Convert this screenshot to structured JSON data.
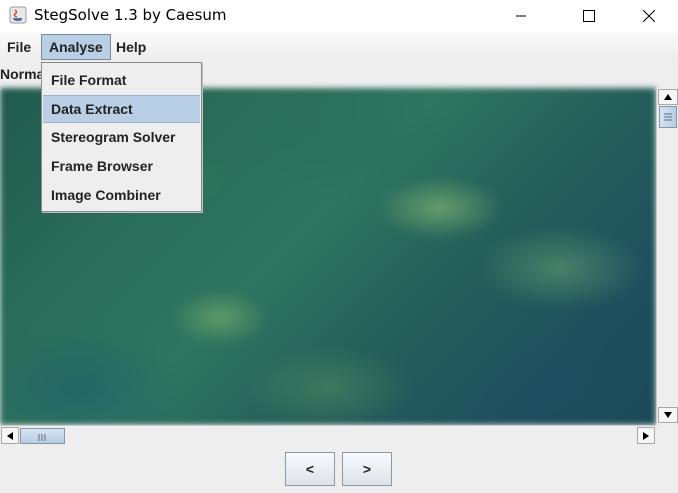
{
  "window": {
    "title": "StegSolve 1.3 by Caesum",
    "minimize_icon": "minimize-icon",
    "maximize_icon": "maximize-icon",
    "close_icon": "close-icon"
  },
  "menubar": {
    "items": [
      "File",
      "Analyse",
      "Help"
    ],
    "active": "Analyse"
  },
  "analyse_menu": {
    "items": [
      "File Format",
      "Data Extract",
      "Stereogram Solver",
      "Frame Browser",
      "Image Combiner"
    ],
    "highlighted": "Data Extract"
  },
  "view": {
    "mode_label": "Normal"
  },
  "nav": {
    "prev_label": "<",
    "next_label": ">"
  },
  "colors": {
    "menu_highlight": "#b8cfe5",
    "background": "#eeeeee"
  }
}
